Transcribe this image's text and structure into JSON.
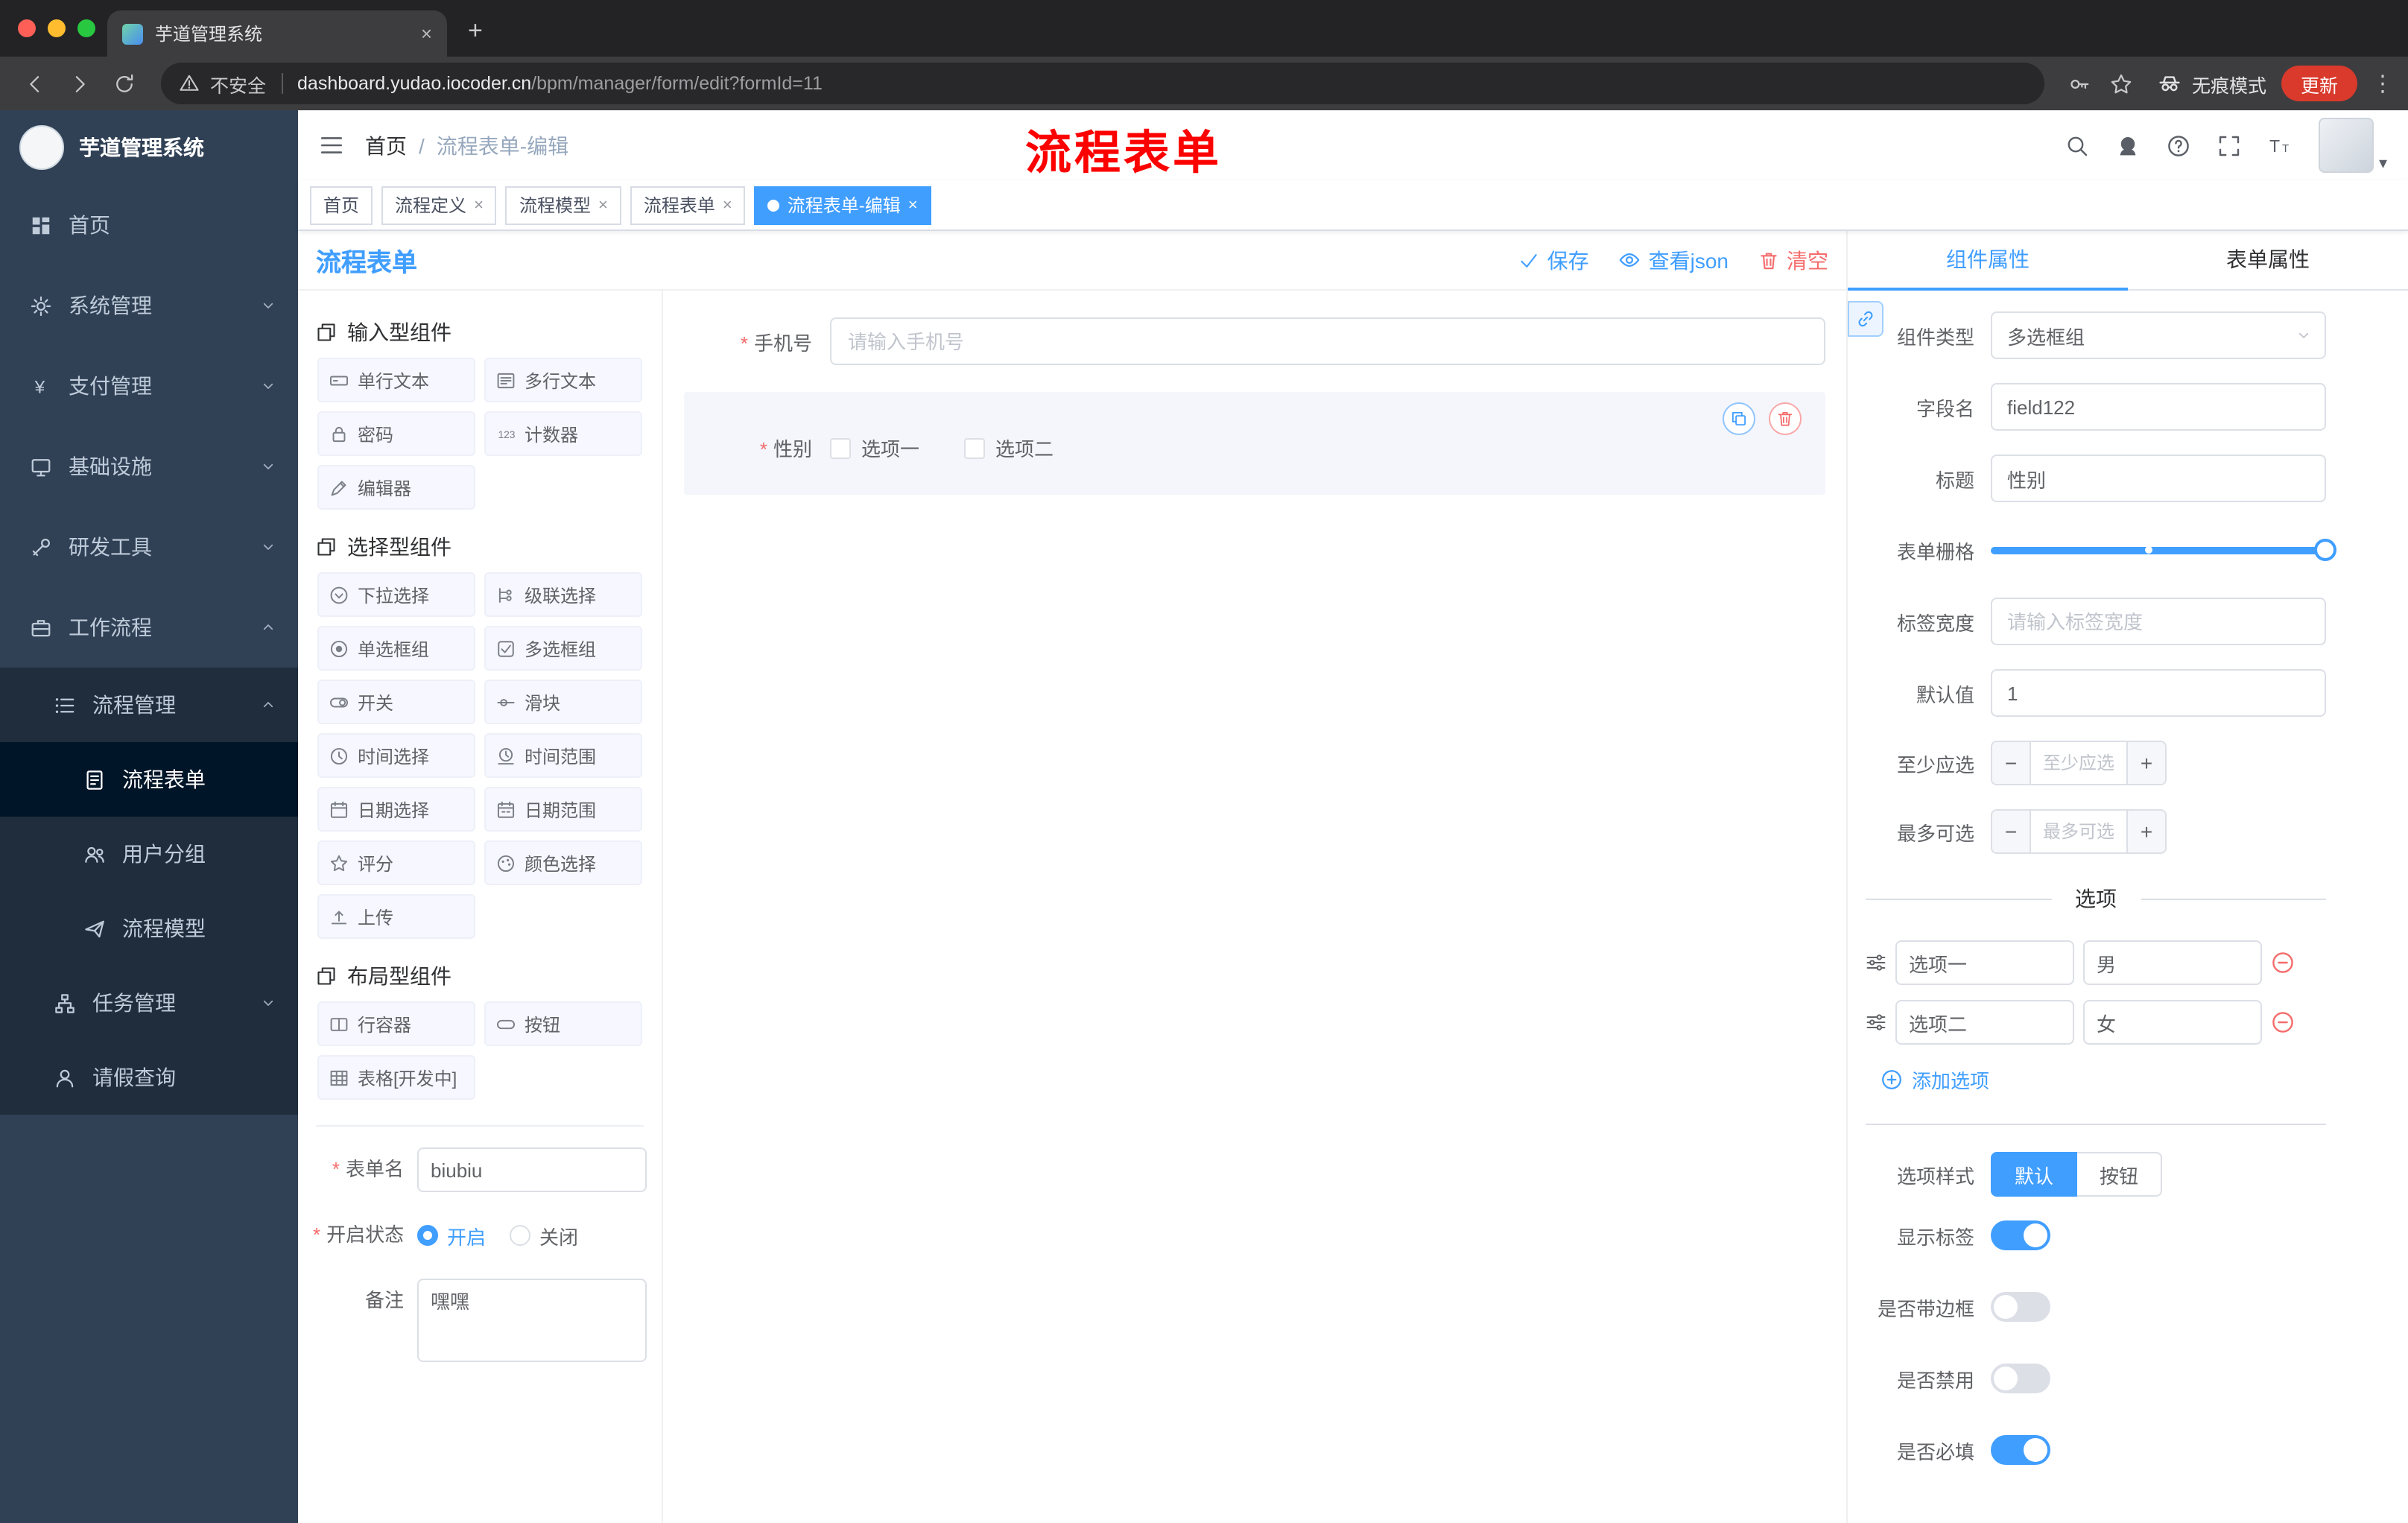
{
  "colors": {
    "primary": "#409eff",
    "danger": "#f56c6c",
    "sidebar_bg": "#304156",
    "sidebar_sub_bg": "#1f2d3d",
    "annotation_red": "#fb0200",
    "update_chip": "#d93a2b"
  },
  "icons": {
    "close": "×",
    "plus": "+",
    "minus": "−",
    "kebab": "⋮",
    "caret_down": "▾",
    "sep": "/"
  },
  "browser": {
    "tab_title": "芋道管理系统",
    "security": "不安全",
    "url_host": "dashboard.yudao.iocoder.cn",
    "url_path": "/bpm/manager/form/edit?formId=11",
    "incognito": "无痕模式",
    "update": "更新"
  },
  "sidebar": {
    "brand": "芋道管理系统",
    "top_items": [
      "首页",
      "系统管理",
      "支付管理",
      "基础设施",
      "研发工具",
      "工作流程"
    ],
    "sub_group": "流程管理",
    "sub_items": [
      "流程表单",
      "用户分组",
      "流程模型"
    ],
    "active_item": "流程表单",
    "lower_items": [
      "任务管理",
      "请假查询"
    ]
  },
  "header": {
    "breadcrumb_home": "首页",
    "breadcrumb_current": "流程表单-编辑",
    "annotation": "流程表单"
  },
  "tags": [
    "首页",
    "流程定义",
    "流程模型",
    "流程表单",
    "流程表单-编辑"
  ],
  "active_tag": "流程表单-编辑",
  "designer": {
    "title": "流程表单",
    "actions": {
      "save": "保存",
      "view_json": "查看json",
      "clear": "清空"
    },
    "groups": [
      {
        "title": "输入型组件",
        "items": [
          "单行文本",
          "多行文本",
          "密码",
          "计数器",
          "编辑器"
        ]
      },
      {
        "title": "选择型组件",
        "items": [
          "下拉选择",
          "级联选择",
          "单选框组",
          "多选框组",
          "开关",
          "滑块",
          "时间选择",
          "时间范围",
          "日期选择",
          "日期范围",
          "评分",
          "颜色选择",
          "上传"
        ]
      },
      {
        "title": "布局型组件",
        "items": [
          "行容器",
          "按钮",
          "表格[开发中]"
        ]
      }
    ],
    "meta": {
      "form_name_label": "表单名",
      "form_name_value": "biubiu",
      "status_label": "开启状态",
      "status_on": "开启",
      "status_off": "关闭",
      "status_selected": "开启",
      "remark_label": "备注",
      "remark_value": "嘿嘿"
    },
    "canvas": {
      "phone_label": "手机号",
      "phone_placeholder": "请输入手机号",
      "gender_label": "性别",
      "gender_options": [
        "选项一",
        "选项二"
      ]
    }
  },
  "props": {
    "tab_component": "组件属性",
    "tab_form": "表单属性",
    "component_type_label": "组件类型",
    "component_type_value": "多选框组",
    "field_name_label": "字段名",
    "field_name_value": "field122",
    "title_label": "标题",
    "title_value": "性别",
    "grid_label": "表单栅格",
    "label_width_label": "标签宽度",
    "label_width_placeholder": "请输入标签宽度",
    "default_label": "默认值",
    "default_value": "1",
    "min_label": "至少应选",
    "min_placeholder": "至少应选",
    "max_label": "最多可选",
    "max_placeholder": "最多可选",
    "options_title": "选项",
    "options": [
      {
        "label": "选项一",
        "value": "男"
      },
      {
        "label": "选项二",
        "value": "女"
      }
    ],
    "add_option": "添加选项",
    "style_label": "选项样式",
    "style_default": "默认",
    "style_button": "按钮",
    "style_selected": "默认",
    "toggles": [
      {
        "label": "显示标签",
        "on": true
      },
      {
        "label": "是否带边框",
        "on": false
      },
      {
        "label": "是否禁用",
        "on": false
      },
      {
        "label": "是否必填",
        "on": true
      }
    ]
  }
}
